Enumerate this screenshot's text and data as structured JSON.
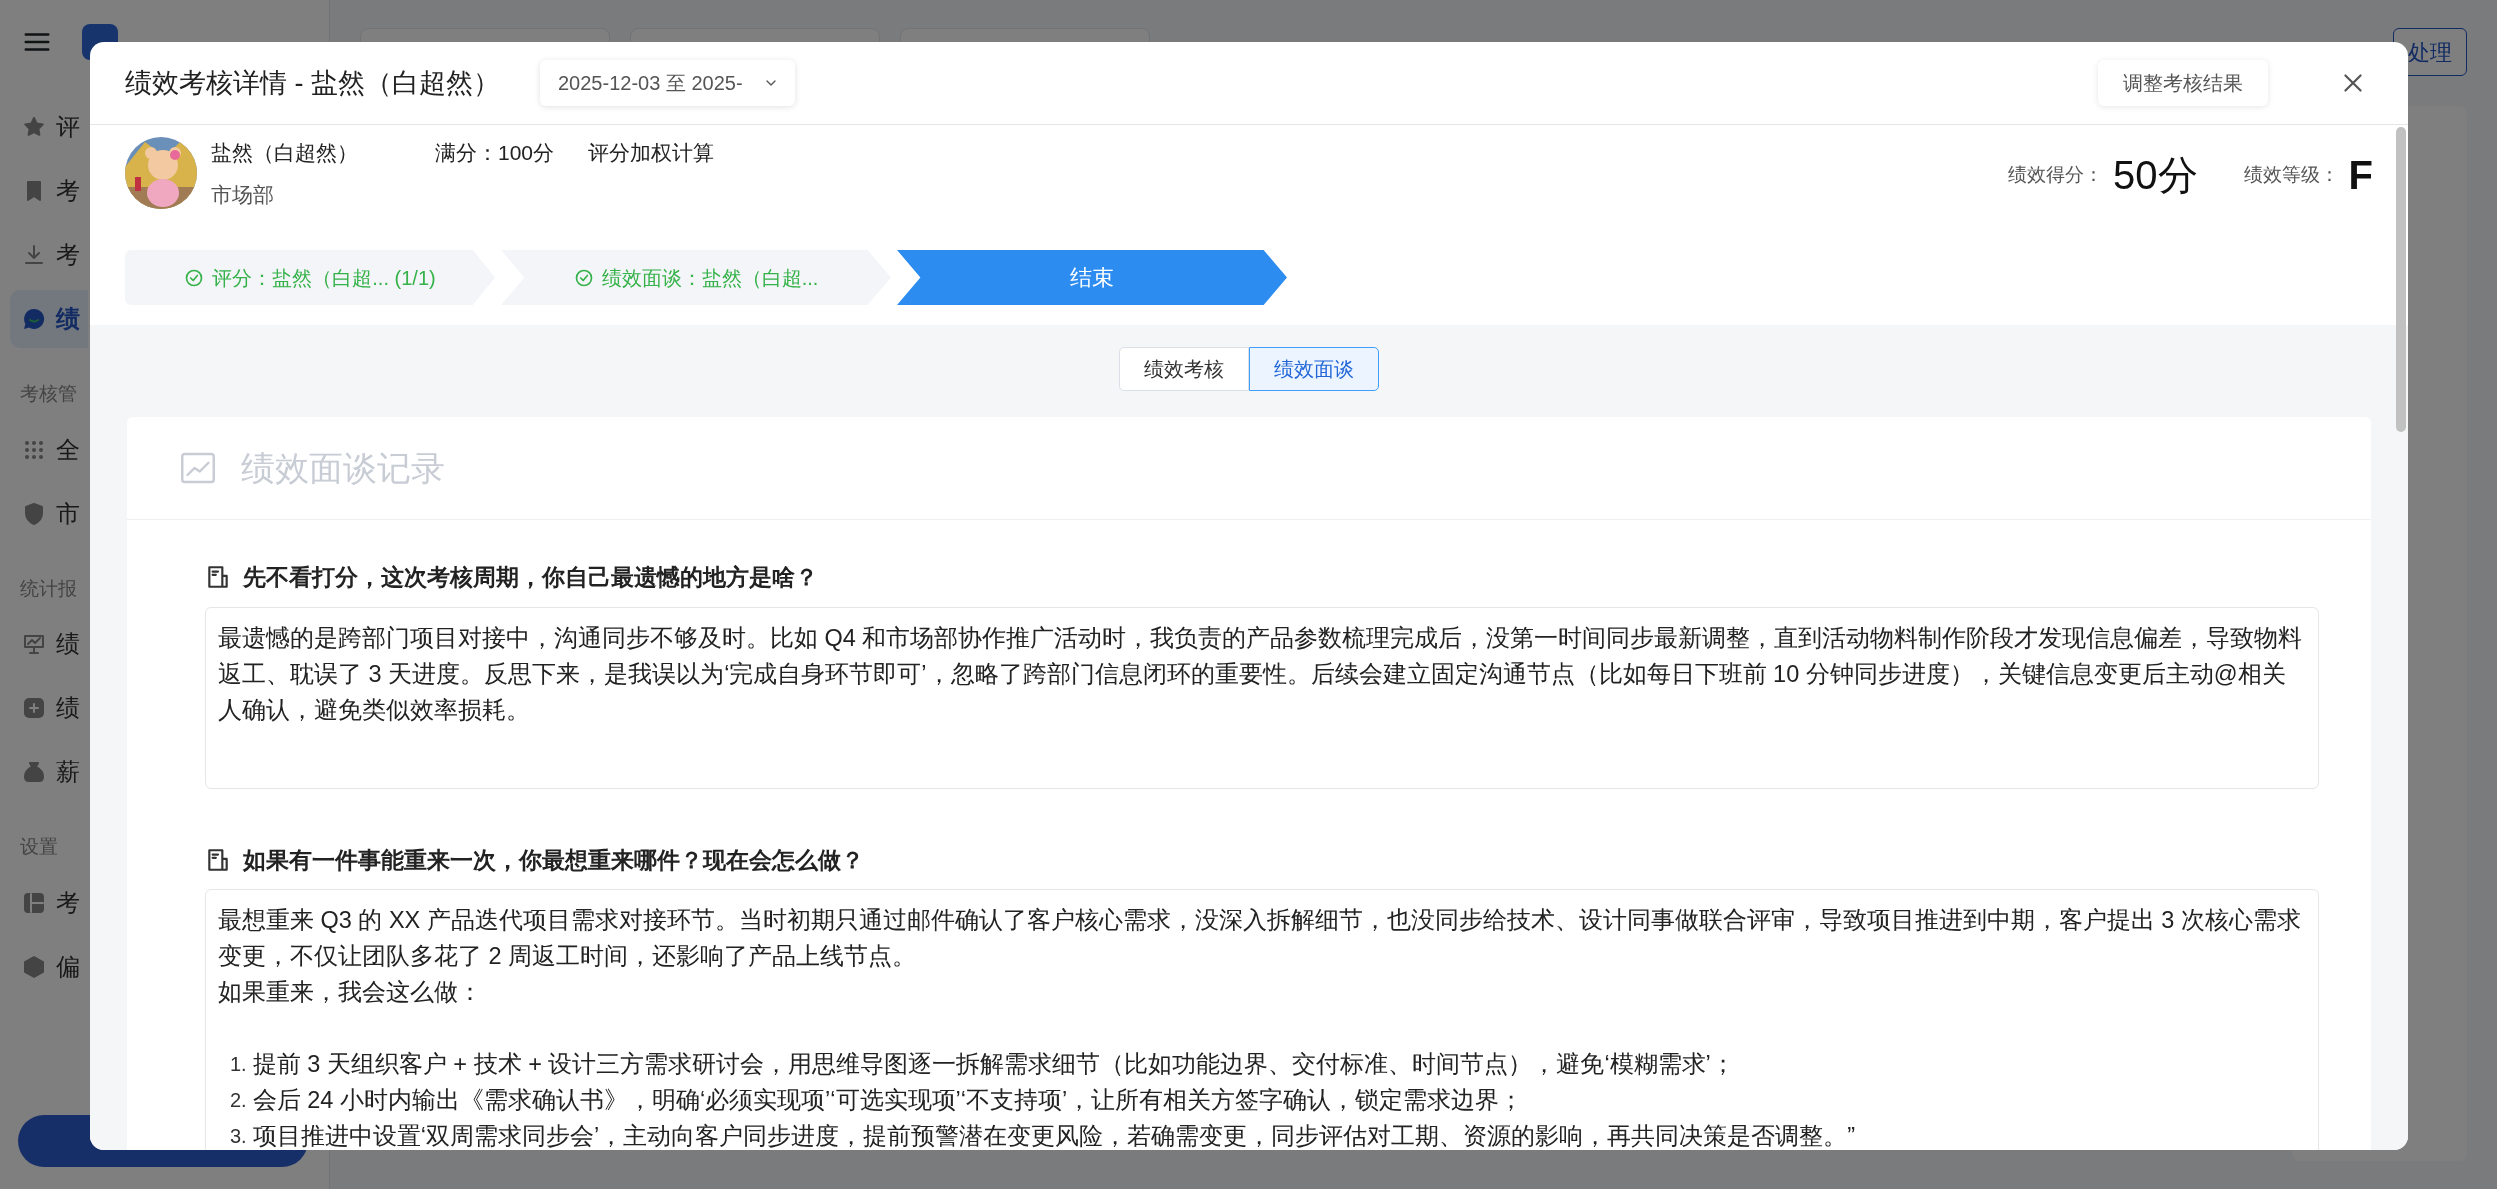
{
  "app": {
    "sidebar": [
      {
        "kind": "item",
        "label": "评",
        "selected": false
      },
      {
        "kind": "item",
        "label": "考",
        "selected": false
      },
      {
        "kind": "item",
        "label": "考",
        "selected": false
      },
      {
        "kind": "item",
        "label": "绩",
        "selected": true
      },
      {
        "kind": "section",
        "label": "考核管"
      },
      {
        "kind": "item",
        "label": "全",
        "selected": false
      },
      {
        "kind": "item",
        "label": "市",
        "selected": false
      },
      {
        "kind": "section",
        "label": "统计报"
      },
      {
        "kind": "item",
        "label": "绩",
        "selected": false
      },
      {
        "kind": "item",
        "label": "绩",
        "selected": false
      },
      {
        "kind": "item",
        "label": "薪",
        "selected": false
      },
      {
        "kind": "section",
        "label": "设置"
      },
      {
        "kind": "item",
        "label": "考",
        "selected": false
      },
      {
        "kind": "item",
        "label": "偏",
        "selected": false
      }
    ],
    "top_button": "处理"
  },
  "modal": {
    "title": "绩效考核详情 - 盐然（白超然）",
    "date_range": "2025-12-03 至 2025-",
    "adjust_button": "调整考核结果",
    "profile": {
      "name": "盐然（白超然）",
      "department": "市场部",
      "full_score": "满分：100分",
      "method": "评分加权计算",
      "score_label": "绩效得分：",
      "score": "50分",
      "grade_label": "绩效等级：",
      "grade": "F"
    },
    "steps": [
      {
        "label": "评分：盐然（白超... (1/1)",
        "kind": "done"
      },
      {
        "label": "绩效面谈：盐然（白超...",
        "kind": "done"
      },
      {
        "label": "结束",
        "kind": "current"
      }
    ],
    "tabs": [
      {
        "label": "绩效考核",
        "selected": false
      },
      {
        "label": "绩效面谈",
        "selected": true
      }
    ],
    "record": {
      "title": "绩效面谈记录",
      "questions": [
        {
          "question": "先不看打分，这次考核周期，你自己最遗憾的地方是啥？",
          "paragraphs": [
            "最遗憾的是跨部门项目对接中，沟通同步不够及时。比如 Q4 和市场部协作推广活动时，我负责的产品参数梳理完成后，没第一时间同步最新调整，直到活动物料制作阶段才发现信息偏差，导致物料返工、耽误了 3 天进度。反思下来，是我误以为‘完成自身环节即可’，忽略了跨部门信息闭环的重要性。后续会建立固定沟通节点（比如每日下班前 10 分钟同步进度），关键信息变更后主动@相关人确认，避免类似效率损耗。"
          ]
        },
        {
          "question": "如果有一件事能重来一次，你最想重来哪件？现在会怎么做？",
          "paragraphs": [
            "最想重来 Q3 的 XX 产品迭代项目需求对接环节。当时初期只通过邮件确认了客户核心需求，没深入拆解细节，也没同步给技术、设计同事做联合评审，导致项目推进到中期，客户提出 3 次核心需求变更，不仅让团队多花了 2 周返工时间，还影响了产品上线节点。",
            "如果重来，我会这么做："
          ],
          "steps": [
            {
              "marker": "1.",
              "text": "提前 3 天组织客户 + 技术 + 设计三方需求研讨会，用思维导图逐一拆解需求细节（比如功能边界、交付标准、时间节点），避免‘模糊需求’；"
            },
            {
              "marker": "2.",
              "text": "会后 24 小时内输出《需求确认书》，明确‘必须实现项’‘可选实现项’‘不支持项’，让所有相关方签字确认，锁定需求边界；"
            },
            {
              "marker": "3.",
              "text": "项目推进中设置‘双周需求同步会’，主动向客户同步进度，提前预警潜在变更风险，若确需变更，同步评估对工期、资源的影响，再共同决策是否调整。”"
            }
          ]
        }
      ]
    }
  }
}
